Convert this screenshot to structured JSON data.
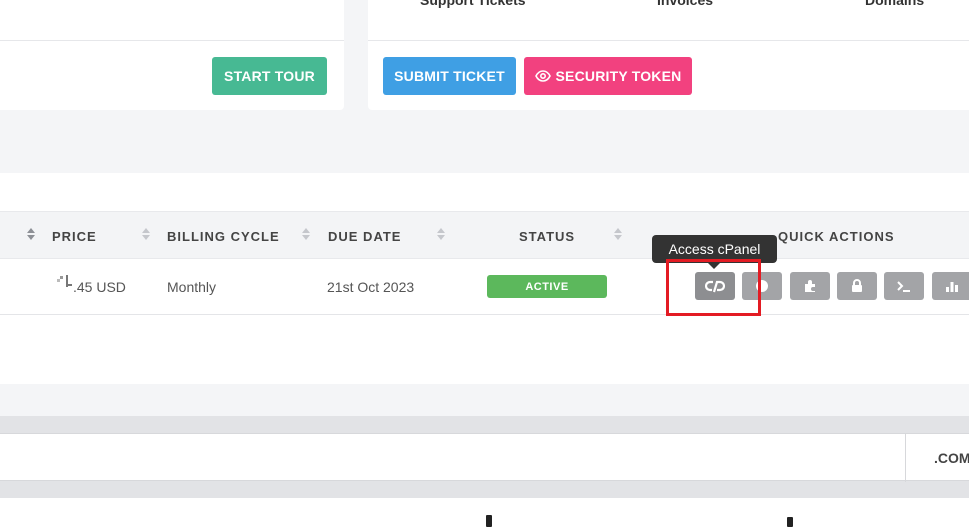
{
  "top_tabs": [
    "Support Tickets",
    "Invoices",
    "Domains"
  ],
  "buttons": {
    "start_tour": "START TOUR",
    "submit_ticket": "SUBMIT TICKET",
    "security_token": "SECURITY TOKEN"
  },
  "table": {
    "headers": {
      "price": "PRICE",
      "billing_cycle": "BILLING CYCLE",
      "due_date": "DUE DATE",
      "status": "STATUS",
      "quick_actions": "QUICK ACTIONS"
    },
    "row": {
      "price": ".45 USD",
      "billing_cycle": "Monthly",
      "due_date": "21st Oct 2023",
      "status": "ACTIVE"
    },
    "quick_actions": [
      "cpanel-icon",
      "webmail-icon",
      "plugin-icon",
      "lock-icon",
      "terminal-icon",
      "stats-icon"
    ]
  },
  "tooltip": "Access cPanel",
  "domain_search": {
    "tld": ".COM"
  },
  "colors": {
    "start_tour": "#47b993",
    "submit_ticket": "#3f9fe4",
    "security_token": "#f2417f",
    "status_active": "#5cb85c",
    "highlight": "#e31b23"
  }
}
